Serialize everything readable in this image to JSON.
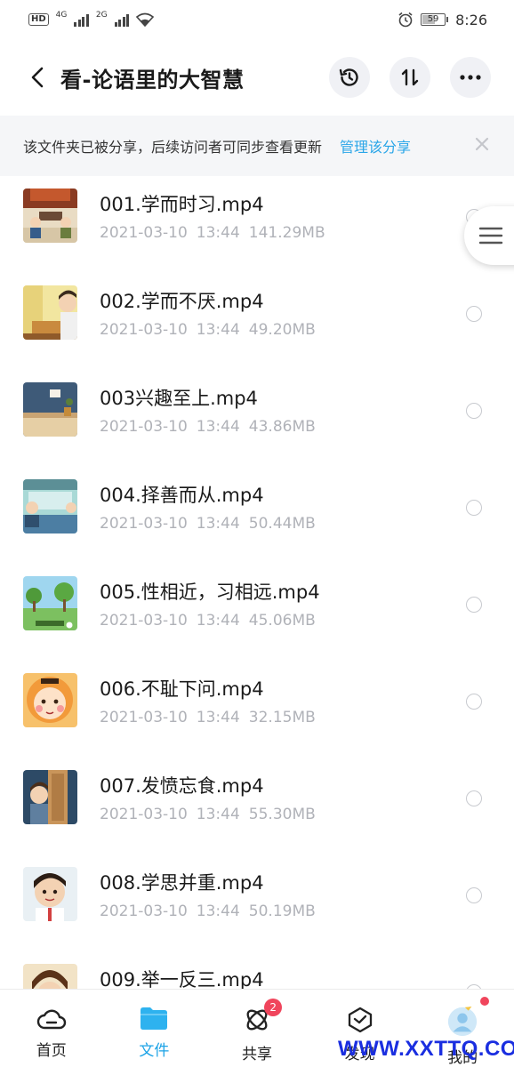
{
  "status_bar": {
    "hd": "HD",
    "net1": "4G",
    "net2": "2G",
    "battery": "59",
    "time": "8:26"
  },
  "header": {
    "title": "看-论语里的大智慧"
  },
  "share_banner": {
    "text": "该文件夹已被分享，后续访问者可同步查看更新",
    "link": "管理该分享"
  },
  "files": [
    {
      "name": "001.学而时习.mp4",
      "date": "2021-03-10",
      "time": "13:44",
      "size": "141.29MB"
    },
    {
      "name": "002.学而不厌.mp4",
      "date": "2021-03-10",
      "time": "13:44",
      "size": "49.20MB"
    },
    {
      "name": "003兴趣至上.mp4",
      "date": "2021-03-10",
      "time": "13:44",
      "size": "43.86MB"
    },
    {
      "name": "004.择善而从.mp4",
      "date": "2021-03-10",
      "time": "13:44",
      "size": "50.44MB"
    },
    {
      "name": "005.性相近，习相远.mp4",
      "date": "2021-03-10",
      "time": "13:44",
      "size": "45.06MB"
    },
    {
      "name": "006.不耻下问.mp4",
      "date": "2021-03-10",
      "time": "13:44",
      "size": "32.15MB"
    },
    {
      "name": "007.发愤忘食.mp4",
      "date": "2021-03-10",
      "time": "13:44",
      "size": "55.30MB"
    },
    {
      "name": "008.学思并重.mp4",
      "date": "2021-03-10",
      "time": "13:44",
      "size": "50.19MB"
    },
    {
      "name": "009.举一反三.mp4",
      "date": "",
      "time": "",
      "size": ""
    }
  ],
  "nav": {
    "items": [
      {
        "label": "首页"
      },
      {
        "label": "文件"
      },
      {
        "label": "共享",
        "badge": "2"
      },
      {
        "label": "发现"
      },
      {
        "label": "我的"
      }
    ]
  },
  "watermark": "WWW.XXTTQ.COM",
  "colors": {
    "accent": "#1ba3e6",
    "badge": "#f0455c",
    "meta_text": "#b0b2b8"
  }
}
